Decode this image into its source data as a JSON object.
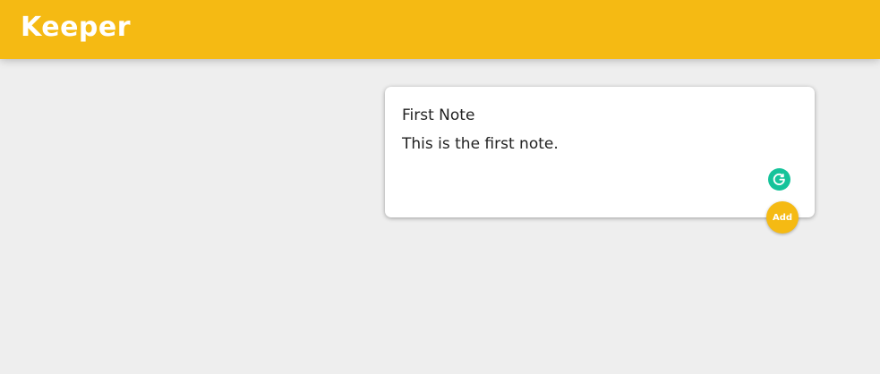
{
  "header": {
    "app_title": "Keeper",
    "background_color": "#f5ba13"
  },
  "note_form": {
    "title_value": "First Note",
    "content_value": "This is the first note.",
    "add_label": "Add",
    "grammarly_icon": "grammarly-icon",
    "accent_color": "#f5ba13"
  }
}
